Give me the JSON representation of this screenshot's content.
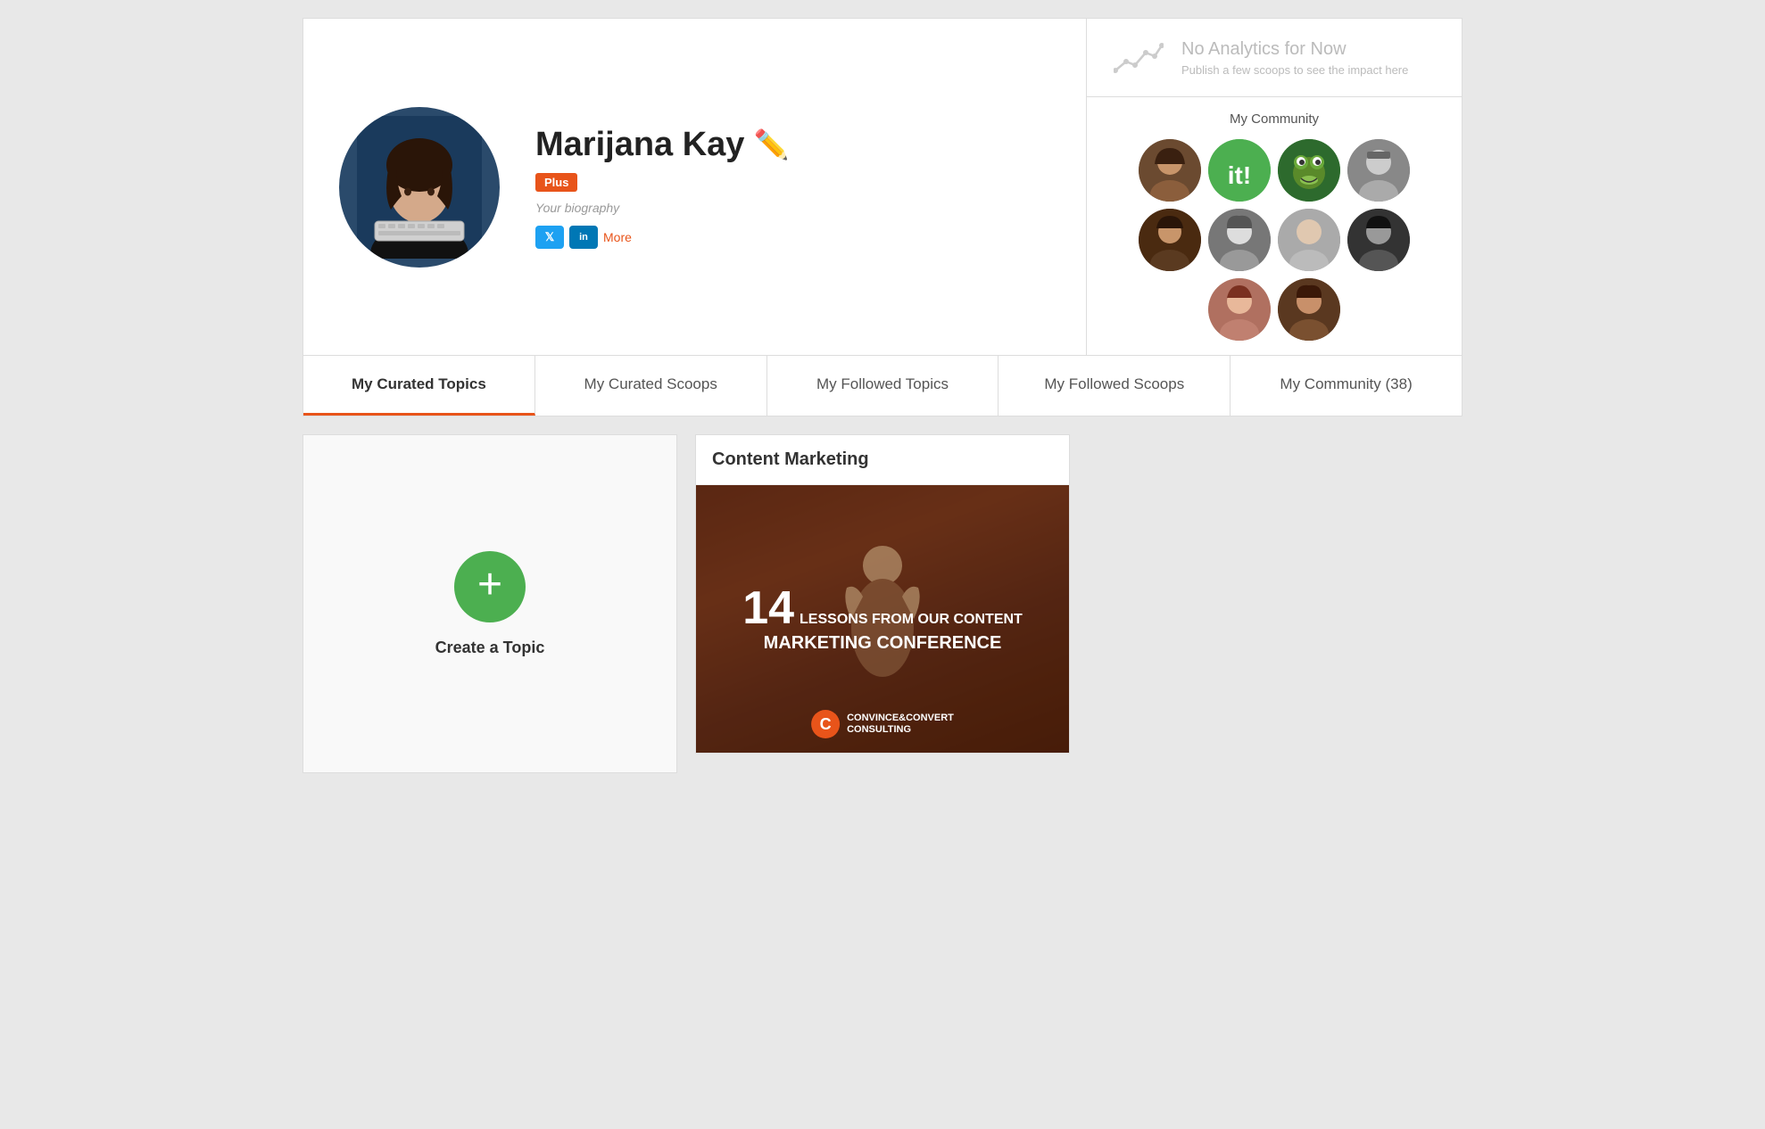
{
  "profile": {
    "name": "Marijana Kay",
    "pencil_emoji": "✏️",
    "badge": "Plus",
    "biography": "Your biography",
    "social": {
      "twitter_label": "t",
      "linkedin_label": "in",
      "more_label": "More"
    }
  },
  "analytics": {
    "title": "No Analytics for Now",
    "subtitle": "Publish a few scoops to see the impact here"
  },
  "community": {
    "title": "My Community",
    "avatars": [
      {
        "label": "👤",
        "index": 1
      },
      {
        "label": "it!",
        "index": 2
      },
      {
        "label": "🐸",
        "index": 3
      },
      {
        "label": "👤",
        "index": 4
      },
      {
        "label": "👤",
        "index": 5
      },
      {
        "label": "👤",
        "index": 6
      },
      {
        "label": "👤",
        "index": 7
      },
      {
        "label": "👤",
        "index": 8
      },
      {
        "label": "👤",
        "index": 9
      },
      {
        "label": "👤",
        "index": 10
      }
    ]
  },
  "tabs": [
    {
      "label": "My Curated Topics",
      "active": true
    },
    {
      "label": "My Curated Scoops",
      "active": false
    },
    {
      "label": "My Followed Topics",
      "active": false
    },
    {
      "label": "My Followed Scoops",
      "active": false
    },
    {
      "label": "My Community (38)",
      "active": false
    }
  ],
  "content": {
    "create_label": "Create a Topic",
    "topic_card": {
      "title": "Content Marketing",
      "image_text_number": "14",
      "image_text_main": "LESSONS FROM OUR CONTENT",
      "image_text_conf": "MARKETING CONFERENCE",
      "brand_name": "CONVINCE&CONVERT",
      "brand_sub": "CONSULTING"
    }
  }
}
